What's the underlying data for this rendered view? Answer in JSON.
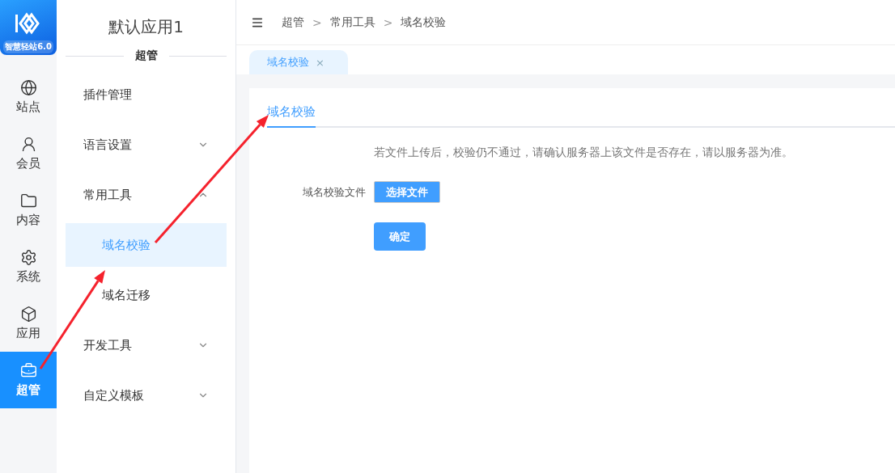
{
  "logo": {
    "caption": "智慧轻站6.0"
  },
  "rail": [
    {
      "label": "站点",
      "kind": "globe",
      "selected": false
    },
    {
      "label": "会员",
      "kind": "user",
      "selected": false
    },
    {
      "label": "内容",
      "kind": "folder",
      "selected": false
    },
    {
      "label": "系统",
      "kind": "settings",
      "selected": false
    },
    {
      "label": "应用",
      "kind": "box",
      "selected": false
    },
    {
      "label": "超管",
      "kind": "briefcase",
      "selected": true
    }
  ],
  "sidebar": {
    "title": "默认应用1",
    "section": "超管",
    "items": [
      {
        "label": "插件管理",
        "kind": "link"
      },
      {
        "label": "语言设置",
        "kind": "group",
        "expanded": false
      },
      {
        "label": "常用工具",
        "kind": "group",
        "expanded": true,
        "children": [
          {
            "label": "域名校验",
            "selected": true
          },
          {
            "label": "域名迁移",
            "selected": false
          }
        ]
      },
      {
        "label": "开发工具",
        "kind": "group",
        "expanded": false
      },
      {
        "label": "自定义模板",
        "kind": "group",
        "expanded": false
      }
    ]
  },
  "breadcrumb": [
    "超管",
    "常用工具",
    "域名校验"
  ],
  "breadcrumb_separator": ">",
  "tabs": [
    {
      "label": "域名校验",
      "selected": true,
      "close": "×"
    }
  ],
  "card": {
    "tabs": [
      {
        "label": "域名校验",
        "selected": true
      }
    ],
    "notice": "若文件上传后，校验仍不通过，请确认服务器上该文件是否存在，请以服务器为准。",
    "field_label": "域名校验文件",
    "file_button": "选择文件",
    "submit": "确定"
  }
}
